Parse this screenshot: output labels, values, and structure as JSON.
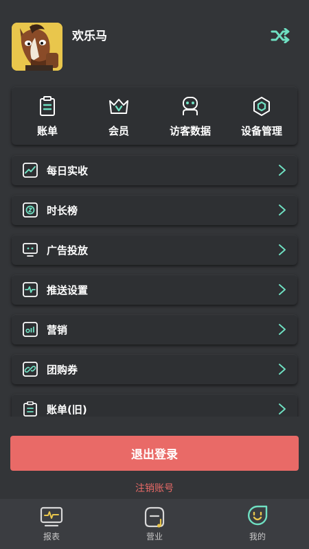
{
  "profile": {
    "username": "欢乐马",
    "avatar_icon": "horse-avatar",
    "switch_icon": "shuffle-icon"
  },
  "quick_actions": [
    {
      "label": "账单",
      "icon": "clipboard-icon"
    },
    {
      "label": "会员",
      "icon": "crown-icon"
    },
    {
      "label": "访客数据",
      "icon": "robot-icon"
    },
    {
      "label": "设备管理",
      "icon": "hexagon-icon"
    }
  ],
  "menu": [
    {
      "label": "每日实收",
      "icon": "trend-chart-icon"
    },
    {
      "label": "时长榜",
      "icon": "hourglass-icon"
    },
    {
      "label": "广告投放",
      "icon": "monitor-icon"
    },
    {
      "label": "推送设置",
      "icon": "pulse-icon"
    },
    {
      "label": "营销",
      "icon": "stats-icon"
    },
    {
      "label": "团购券",
      "icon": "link-icon"
    },
    {
      "label": "账单(旧)",
      "icon": "clipboard-icon"
    }
  ],
  "logout_label": "退出登录",
  "cancel_account_label": "注销账号",
  "tabs": [
    {
      "label": "报表",
      "icon": "report-icon"
    },
    {
      "label": "营业",
      "icon": "business-icon"
    },
    {
      "label": "我的",
      "icon": "smile-icon",
      "active": true
    }
  ],
  "colors": {
    "accent": "#6fe0c2",
    "background": "#333538",
    "card": "#2e3033",
    "danger": "#e96a67",
    "tabbar": "#3b3d41"
  }
}
